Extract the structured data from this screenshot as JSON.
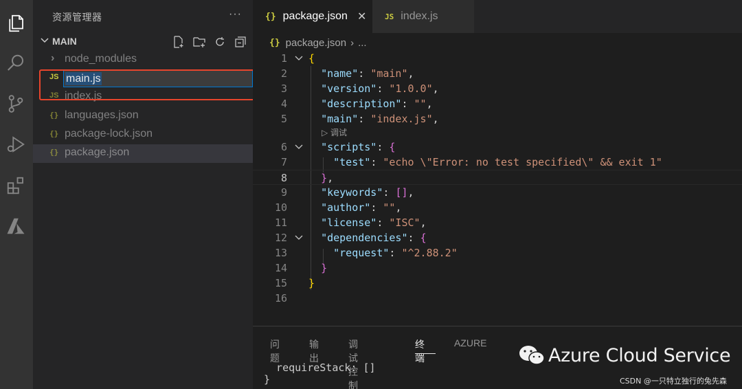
{
  "sidebar": {
    "title": "资源管理器",
    "more": "···",
    "section_label": "MAIN",
    "items": [
      {
        "icon": "›",
        "label": "node_modules"
      },
      {
        "icon": "JS",
        "label": "main.js"
      },
      {
        "icon": "JS",
        "label": "index.js"
      },
      {
        "icon": "{}",
        "label": "languages.json"
      },
      {
        "icon": "{}",
        "label": "package-lock.json"
      },
      {
        "icon": "{}",
        "label": "package.json"
      }
    ],
    "action_icons": [
      "new-file-icon",
      "new-folder-icon",
      "refresh-icon",
      "collapse-all-icon"
    ]
  },
  "tabs": [
    {
      "icon": "{}",
      "label": "package.json",
      "close": "✕"
    },
    {
      "icon": "JS",
      "label": "index.js"
    }
  ],
  "breadcrumb": {
    "icon": "{}",
    "file": "package.json",
    "sep": "›",
    "rest": "..."
  },
  "code": {
    "line_numbers": [
      "1",
      "2",
      "3",
      "4",
      "5",
      "6",
      "7",
      "8",
      "9",
      "10",
      "11",
      "12",
      "13",
      "14",
      "15",
      "16"
    ],
    "codelens": "▷ 调试",
    "l1": "{",
    "l2_key": "\"name\"",
    "l2_val": "\"main\"",
    "l3_key": "\"version\"",
    "l3_val": "\"1.0.0\"",
    "l4_key": "\"description\"",
    "l4_val": "\"\"",
    "l5_key": "\"main\"",
    "l5_val": "\"index.js\"",
    "l6_key": "\"scripts\"",
    "l6_brace": "{",
    "l7_key": "\"test\"",
    "l7_val": "\"echo \\\"Error: no test specified\\\" && exit 1\"",
    "l8": "}",
    "l9_key": "\"keywords\"",
    "l9_val": "[]",
    "l10_key": "\"author\"",
    "l10_val": "\"\"",
    "l11_key": "\"license\"",
    "l11_val": "\"ISC\"",
    "l12_key": "\"dependencies\"",
    "l12_brace": "{",
    "l13_key": "\"request\"",
    "l13_val": "\"^2.88.2\"",
    "l14": "}",
    "l15": "}"
  },
  "panel": {
    "tabs": [
      "问题",
      "输出",
      "调试控制台",
      "终端",
      "AZURE"
    ],
    "active_tab": "终端",
    "terminal_lines": [
      "  requireStack: []",
      "}"
    ]
  },
  "watermark": {
    "text": "Azure Cloud Service",
    "credit": "CSDN @一只特立独行的兔先森"
  },
  "colors": {
    "highlight": "#e8452c",
    "accent": "#0078d4",
    "json_icon": "#cbcb41"
  }
}
